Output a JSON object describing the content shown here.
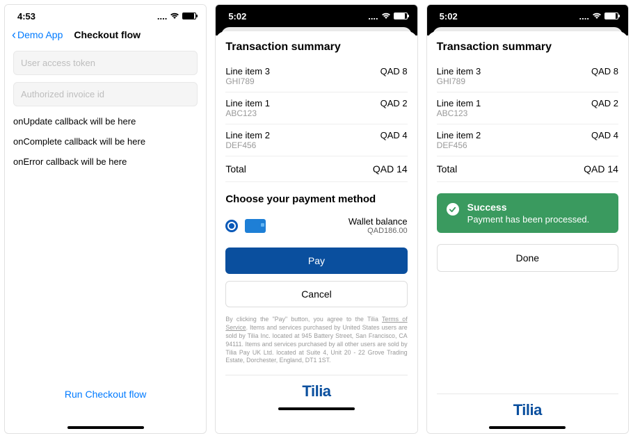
{
  "screen1": {
    "time": "4:53",
    "back_label": "Demo App",
    "title": "Checkout flow",
    "input_token_placeholder": "User access token",
    "input_invoice_placeholder": "Authorized invoice id",
    "callbacks": {
      "update": "onUpdate callback will be here",
      "complete": "onComplete callback will be here",
      "error": "onError callback will be here"
    },
    "run_label": "Run Checkout flow"
  },
  "screen2": {
    "time": "5:02",
    "summary_title": "Transaction summary",
    "items": [
      {
        "name": "Line item 3",
        "code": "GHI789",
        "amount": "QAD 8"
      },
      {
        "name": "Line item 1",
        "code": "ABC123",
        "amount": "QAD 2"
      },
      {
        "name": "Line item 2",
        "code": "DEF456",
        "amount": "QAD 4"
      }
    ],
    "total_label": "Total",
    "total_amount": "QAD 14",
    "pm_title": "Choose your payment method",
    "wallet_label": "Wallet balance",
    "wallet_amount": "QAD186.00",
    "pay_label": "Pay",
    "cancel_label": "Cancel",
    "legal_prefix": "By clicking the \"Pay\" button, you agree to the Tilia ",
    "legal_tos": "Terms of Service",
    "legal_rest": ". Items and services purchased by United States users are sold by Tilia Inc. located at 945 Battery Street, San Francisco, CA 94111. Items and services purchased by all other users are sold by Tilia Pay UK Ltd. located at Suite 4, Unit 20 - 22 Grove Trading Estate, Dorchester, England, DT1 1ST.",
    "brand": "Tilia"
  },
  "screen3": {
    "time": "5:02",
    "summary_title": "Transaction summary",
    "items": [
      {
        "name": "Line item 3",
        "code": "GHI789",
        "amount": "QAD 8"
      },
      {
        "name": "Line item 1",
        "code": "ABC123",
        "amount": "QAD 2"
      },
      {
        "name": "Line item 2",
        "code": "DEF456",
        "amount": "QAD 4"
      }
    ],
    "total_label": "Total",
    "total_amount": "QAD 14",
    "success_title": "Success",
    "success_msg": "Payment has been processed.",
    "done_label": "Done",
    "brand": "Tilia"
  }
}
